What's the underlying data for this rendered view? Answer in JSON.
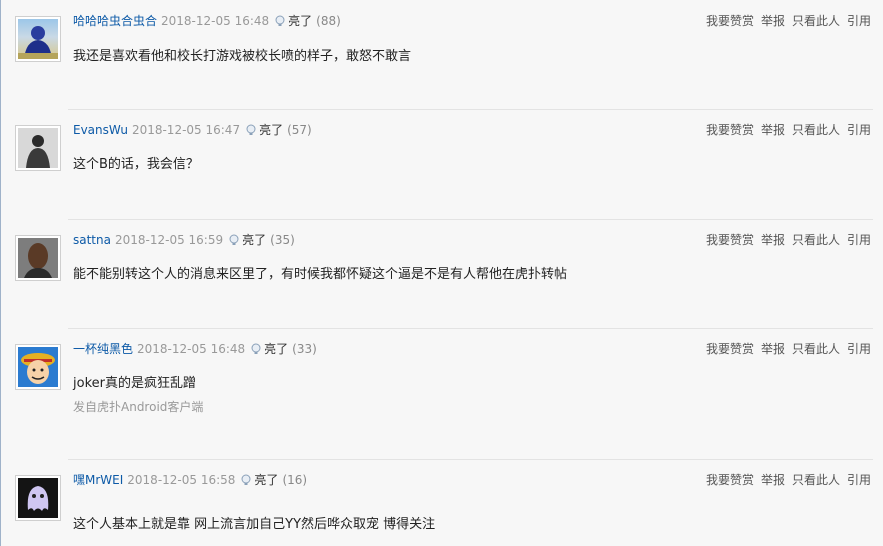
{
  "actions": {
    "reward": "我要赞赏",
    "report": "举报",
    "only_this": "只看此人",
    "quote": "引用"
  },
  "light_label": "亮了",
  "replies": [
    {
      "username": "哈哈哈虫合虫合",
      "time": "2018-12-05 16:48",
      "count": "(88)",
      "content": "我还是喜欢看他和校长打游戏被校长喷的样子，敢怒不敢言",
      "source": ""
    },
    {
      "username": "EvansWu",
      "time": "2018-12-05 16:47",
      "count": "(57)",
      "content": "这个B的话，我会信？",
      "source": ""
    },
    {
      "username": "sattna",
      "time": "2018-12-05 16:59",
      "count": "(35)",
      "content": "能不能别转这个人的消息来区里了，有时候我都怀疑这个逼是不是有人帮他在虎扑转帖",
      "source": ""
    },
    {
      "username": "一杯纯黑色",
      "time": "2018-12-05 16:48",
      "count": "(33)",
      "content": "joker真的是疯狂乱蹭",
      "source": "发自虎扑Android客户端"
    },
    {
      "username": "嘿MrWEI",
      "time": "2018-12-05 16:58",
      "count": "(16)",
      "content": "这个人基本上就是靠 网上流言加自己YY然后哗众取宠 博得关注",
      "source": ""
    }
  ]
}
